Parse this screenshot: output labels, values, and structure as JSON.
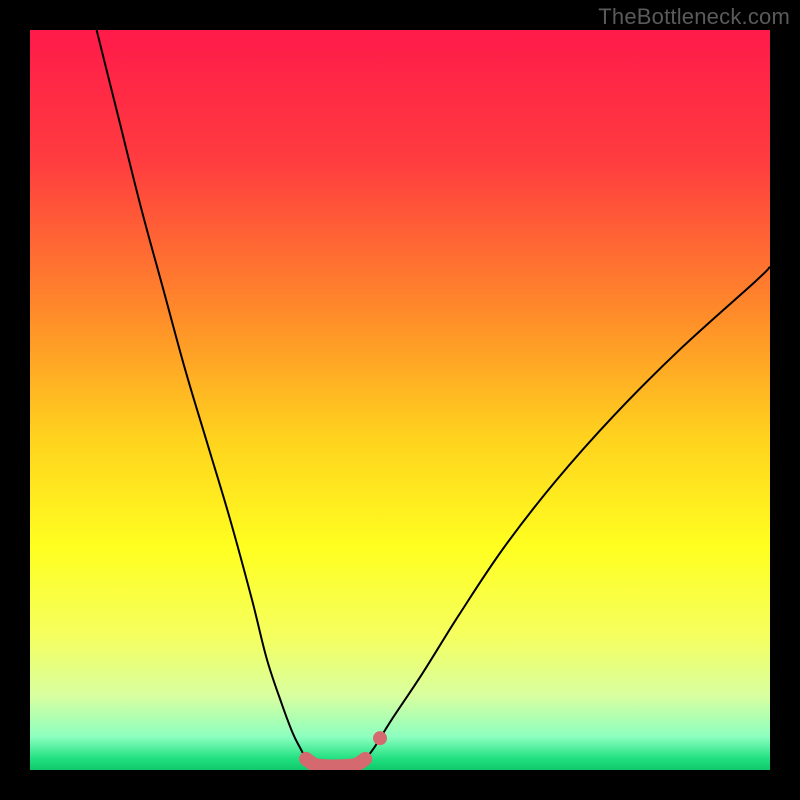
{
  "watermark": "TheBottleneck.com",
  "chart_data": {
    "type": "line",
    "title": "",
    "xlabel": "",
    "ylabel": "",
    "xlim": [
      0,
      100
    ],
    "ylim": [
      0,
      100
    ],
    "background_gradient": [
      {
        "pos": 0.0,
        "color": "#ff1a4a"
      },
      {
        "pos": 0.18,
        "color": "#ff3d3f"
      },
      {
        "pos": 0.38,
        "color": "#ff8a2a"
      },
      {
        "pos": 0.55,
        "color": "#ffd21e"
      },
      {
        "pos": 0.7,
        "color": "#ffff20"
      },
      {
        "pos": 0.82,
        "color": "#f5ff60"
      },
      {
        "pos": 0.9,
        "color": "#d8ffa0"
      },
      {
        "pos": 0.955,
        "color": "#8cffc0"
      },
      {
        "pos": 0.985,
        "color": "#20e080"
      },
      {
        "pos": 1.0,
        "color": "#10c86a"
      }
    ],
    "series": [
      {
        "name": "bottleneck-curve-left",
        "stroke": "#000000",
        "stroke_width": 2,
        "x": [
          9,
          12,
          15,
          18,
          21,
          24,
          27,
          30,
          32,
          34,
          35.5,
          36.5,
          37.3
        ],
        "y": [
          100,
          88,
          76,
          65,
          54,
          44,
          34,
          23,
          15,
          9,
          5,
          3,
          1.5
        ]
      },
      {
        "name": "bottleneck-curve-right",
        "stroke": "#000000",
        "stroke_width": 2,
        "x": [
          45.3,
          46.5,
          49,
          53,
          58,
          64,
          71,
          79,
          88,
          98,
          100
        ],
        "y": [
          1.5,
          3,
          7,
          13,
          21,
          30,
          39,
          48,
          57,
          66,
          68
        ]
      },
      {
        "name": "valley-floor",
        "stroke": "#d46a6f",
        "stroke_width": 14,
        "linecap": "round",
        "x": [
          37.3,
          38.5,
          40.0,
          42.0,
          44.0,
          45.3
        ],
        "y": [
          1.5,
          0.7,
          0.5,
          0.5,
          0.7,
          1.5
        ]
      }
    ],
    "markers": [
      {
        "name": "valley-dot-right",
        "x": 47.3,
        "y": 4.3,
        "r": 7,
        "color": "#d46a6f"
      }
    ]
  }
}
